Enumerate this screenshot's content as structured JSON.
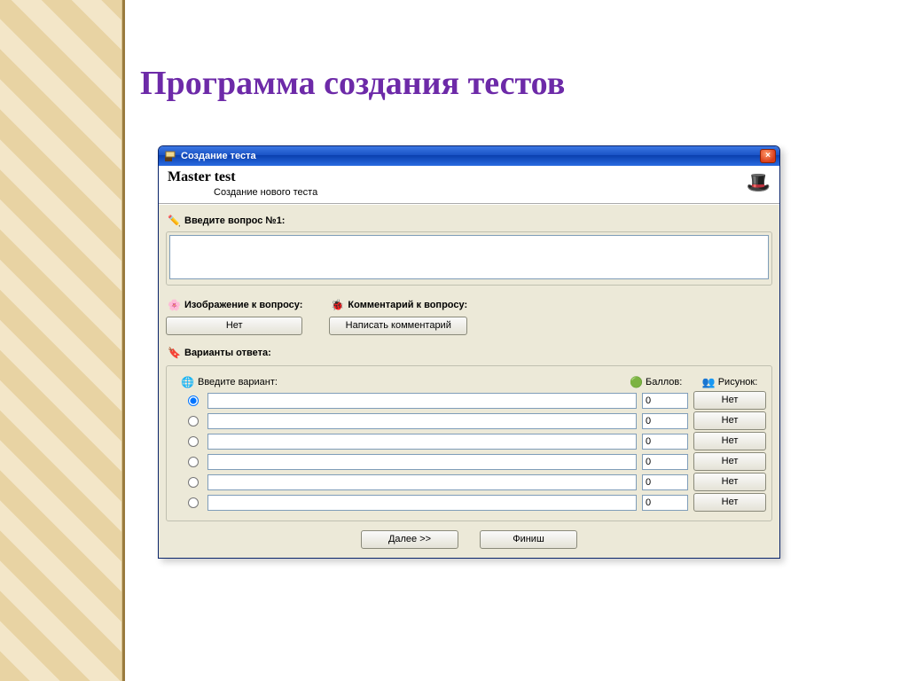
{
  "slide_title": "Программа создания тестов",
  "window": {
    "title": "Создание теста",
    "close_glyph": "×",
    "header": {
      "app": "Master test",
      "subtitle": "Создание нового теста"
    }
  },
  "question": {
    "label": "Введите вопрос №1:",
    "value": ""
  },
  "image_section": {
    "label": "Изображение к вопросу:",
    "button": "Нет"
  },
  "comment_section": {
    "label": "Комментарий к вопросу:",
    "button": "Написать комментарий"
  },
  "answers": {
    "group_label": "Варианты ответа:",
    "col_variant": "Введите вариант:",
    "col_points": "Баллов:",
    "col_image": "Рисунок:",
    "rows": [
      {
        "selected": true,
        "variant": "",
        "points": "0",
        "img": "Нет"
      },
      {
        "selected": false,
        "variant": "",
        "points": "0",
        "img": "Нет"
      },
      {
        "selected": false,
        "variant": "",
        "points": "0",
        "img": "Нет"
      },
      {
        "selected": false,
        "variant": "",
        "points": "0",
        "img": "Нет"
      },
      {
        "selected": false,
        "variant": "",
        "points": "0",
        "img": "Нет"
      },
      {
        "selected": false,
        "variant": "",
        "points": "0",
        "img": "Нет"
      }
    ]
  },
  "footer": {
    "next": "Далее >>",
    "finish": "Финиш"
  }
}
